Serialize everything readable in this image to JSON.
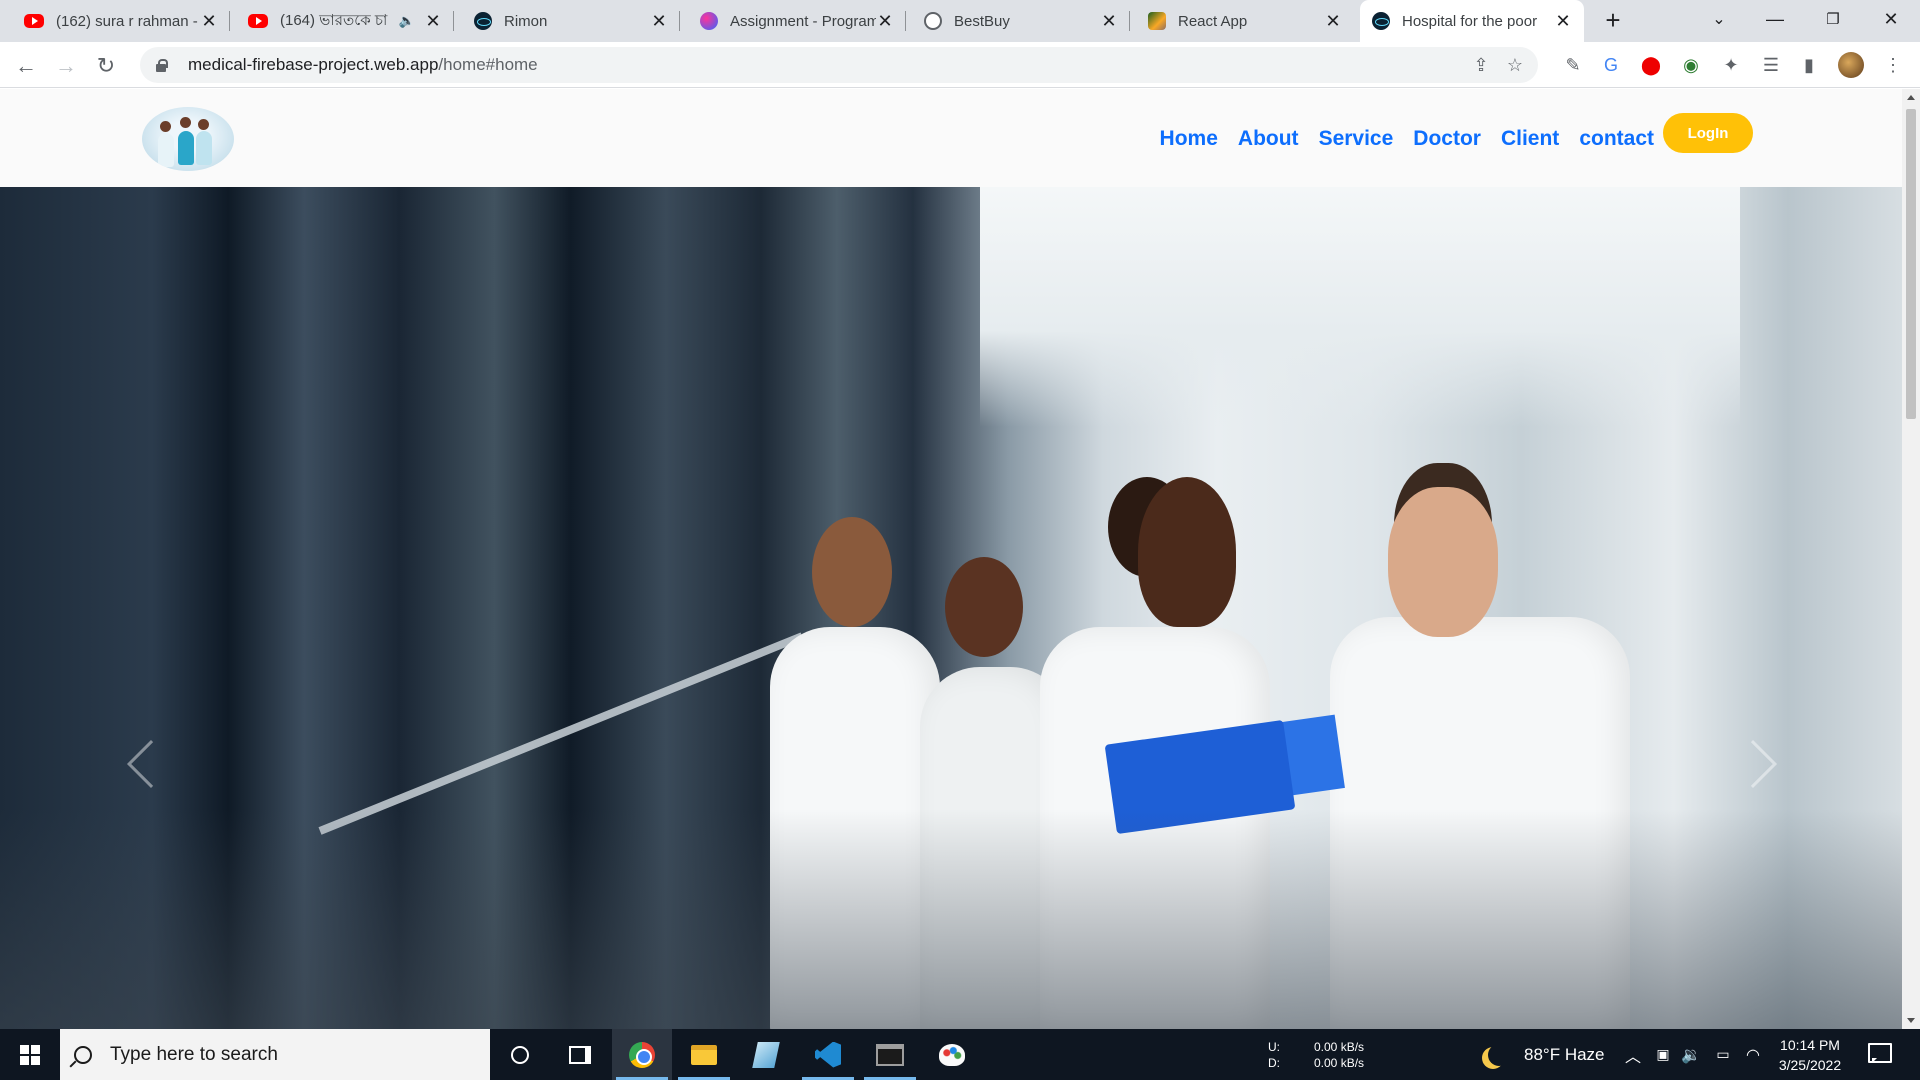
{
  "browser": {
    "tabs": [
      {
        "title": "(162) sura r rahman -",
        "favicon": "youtube-icon"
      },
      {
        "title": "(164) ভারতকে চা",
        "favicon": "youtube-icon",
        "muted": true
      },
      {
        "title": "Rimon",
        "favicon": "react-icon"
      },
      {
        "title": "Assignment - Program",
        "favicon": "assignment-icon"
      },
      {
        "title": "BestBuy",
        "favicon": "globe-icon"
      },
      {
        "title": "React App",
        "favicon": "image-icon"
      },
      {
        "title": "Hospital for the poor",
        "favicon": "react-icon",
        "active": true
      }
    ],
    "url": {
      "host": "medical-firebase-project.web.app",
      "path": "/home#home"
    }
  },
  "site": {
    "nav": [
      "Home",
      "About",
      "Service",
      "Doctor",
      "Client",
      "contact"
    ],
    "login_label": "LogIn"
  },
  "taskbar": {
    "search_placeholder": "Type here to search",
    "net": {
      "up_label": "U:",
      "up_value": "0.00 kB/s",
      "down_label": "D:",
      "down_value": "0.00 kB/s"
    },
    "weather": "88°F  Haze",
    "time": "10:14 PM",
    "date": "3/25/2022"
  },
  "colors": {
    "nav_link": "#0d6efd",
    "login_button": "#ffc107",
    "taskbar": "#0e1621"
  }
}
